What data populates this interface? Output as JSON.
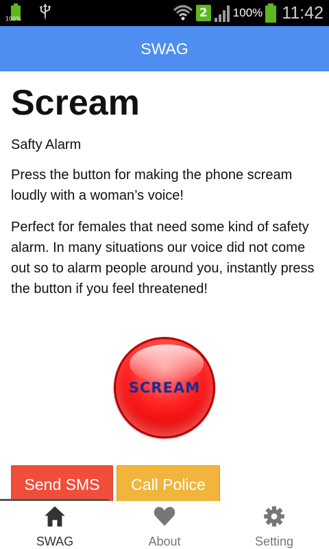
{
  "status_bar": {
    "battery_small_pct": "100%",
    "notification_count": "2",
    "battery_pct": "100%",
    "time": "11:42",
    "accent_color": "#5fb61e"
  },
  "app_bar": {
    "title": "SWAG",
    "color": "#4e8ef0"
  },
  "content": {
    "title": "Scream",
    "subtitle": "Safty Alarm",
    "paragraph1": "Press the button for making the phone scream loudly with a woman’s voice!",
    "paragraph2": "Perfect for females that need some kind of safety alarm. In many situations our voice did not come out so to alarm people around you, instantly press the button if you feel threatened!"
  },
  "scream_button": {
    "label": "SCREAM",
    "color": "#ff2020"
  },
  "actions": {
    "send_sms": {
      "label": "Send SMS",
      "color": "#f04e3a"
    },
    "call_police": {
      "label": "Call Police",
      "color": "#f0b53a"
    }
  },
  "tabs": [
    {
      "label": "SWAG",
      "icon": "home-icon",
      "active": true
    },
    {
      "label": "About",
      "icon": "heart-icon",
      "active": false
    },
    {
      "label": "Setting",
      "icon": "gear-icon",
      "active": false
    }
  ]
}
